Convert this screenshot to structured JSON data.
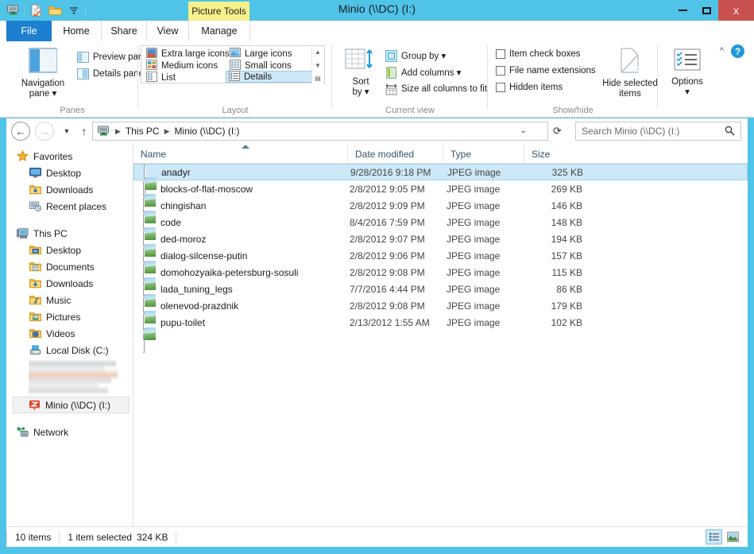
{
  "window": {
    "title": "Minio (\\\\DC) (I:)",
    "context_tab_label": "Picture Tools",
    "minimize_label": "Minimize",
    "maximize_label": "Maximize",
    "close_label": "x",
    "accent_color": "#4fc3e8",
    "close_color": "#c9514e"
  },
  "quick_access": [
    {
      "name": "network-drive-icon",
      "label": "Network drive"
    },
    {
      "name": "properties-icon",
      "label": "Properties"
    },
    {
      "name": "new-folder-icon",
      "label": "New folder"
    },
    {
      "name": "customize-qat-icon",
      "label": "Customize Quick Access Toolbar"
    }
  ],
  "tabs": [
    {
      "label": "File",
      "active": false,
      "kind": "file"
    },
    {
      "label": "Home",
      "active": false,
      "kind": "normal"
    },
    {
      "label": "Share",
      "active": false,
      "kind": "normal"
    },
    {
      "label": "View",
      "active": true,
      "kind": "normal"
    },
    {
      "label": "Manage",
      "active": false,
      "kind": "context"
    }
  ],
  "ribbon": {
    "help_label": "?",
    "collapse_label": "^",
    "groups": [
      {
        "label": "Panes"
      },
      {
        "label": "Layout"
      },
      {
        "label": "Current view"
      },
      {
        "label": "Show/hide"
      }
    ],
    "panes": {
      "navigation_pane": "Navigation\npane",
      "navigation_pane_line1": "Navigation",
      "navigation_pane_line2": "pane",
      "preview_pane": "Preview pane",
      "details_pane": "Details pane"
    },
    "layout": {
      "options": [
        {
          "label": "Extra large icons",
          "selected": false
        },
        {
          "label": "Large icons",
          "selected": false
        },
        {
          "label": "Medium icons",
          "selected": false
        },
        {
          "label": "Small icons",
          "selected": false
        },
        {
          "label": "List",
          "selected": false
        },
        {
          "label": "Details",
          "selected": true
        }
      ]
    },
    "current_view": {
      "sort_by_line1": "Sort",
      "sort_by_line2": "by",
      "group_by": "Group by",
      "add_columns": "Add columns",
      "size_all_columns": "Size all columns to fit"
    },
    "show_hide": {
      "item_check_boxes": {
        "label": "Item check boxes",
        "checked": false
      },
      "file_name_extensions": {
        "label": "File name extensions",
        "checked": false
      },
      "hidden_items": {
        "label": "Hidden items",
        "checked": false
      },
      "hide_selected_line1": "Hide selected",
      "hide_selected_line2": "items",
      "options": "Options"
    }
  },
  "address_bar": {
    "back_label": "Back",
    "forward_label": "Forward",
    "history_label": "Recent locations",
    "up_label": "Up",
    "breadcrumbs": [
      "This PC",
      "Minio (\\\\DC) (I:)"
    ],
    "dropdown_label": "Previous locations",
    "refresh_label": "Refresh",
    "search_placeholder": "Search Minio (\\\\DC) (I:)"
  },
  "nav_pane": {
    "groups": [
      {
        "header": {
          "label": "Favorites",
          "icon": "star-icon"
        },
        "items": [
          {
            "label": "Desktop",
            "icon": "desktop-icon"
          },
          {
            "label": "Downloads",
            "icon": "downloads-folder-icon"
          },
          {
            "label": "Recent places",
            "icon": "recent-places-icon"
          }
        ]
      },
      {
        "header": {
          "label": "This PC",
          "icon": "this-pc-icon"
        },
        "items": [
          {
            "label": "Desktop",
            "icon": "desktop-folder-icon"
          },
          {
            "label": "Documents",
            "icon": "documents-folder-icon"
          },
          {
            "label": "Downloads",
            "icon": "downloads-folder-icon"
          },
          {
            "label": "Music",
            "icon": "music-folder-icon"
          },
          {
            "label": "Pictures",
            "icon": "pictures-folder-icon"
          },
          {
            "label": "Videos",
            "icon": "videos-folder-icon"
          },
          {
            "label": "Local Disk (C:)",
            "icon": "local-disk-icon"
          }
        ]
      }
    ],
    "redacted_block": {
      "label": "",
      "blurred": true
    },
    "selected_drive": {
      "label": "Minio (\\\\DC) (I:)",
      "icon": "network-drive-icon",
      "selected": true
    },
    "network": {
      "label": "Network",
      "icon": "network-icon"
    }
  },
  "file_list": {
    "columns": [
      {
        "label": "Name"
      },
      {
        "label": "Date modified"
      },
      {
        "label": "Type"
      },
      {
        "label": "Size"
      }
    ],
    "sort_column": "Name",
    "sort_direction": "ascending",
    "rows": [
      {
        "name": "anadyr",
        "date": "9/28/2016 9:18 PM",
        "type": "JPEG image",
        "size": "325 KB",
        "selected": true
      },
      {
        "name": "blocks-of-flat-moscow",
        "date": "2/8/2012 9:05 PM",
        "type": "JPEG image",
        "size": "269 KB",
        "selected": false
      },
      {
        "name": "chingishan",
        "date": "2/8/2012 9:09 PM",
        "type": "JPEG image",
        "size": "146 KB",
        "selected": false
      },
      {
        "name": "code",
        "date": "8/4/2016 7:59 PM",
        "type": "JPEG image",
        "size": "148 KB",
        "selected": false
      },
      {
        "name": "ded-moroz",
        "date": "2/8/2012 9:07 PM",
        "type": "JPEG image",
        "size": "194 KB",
        "selected": false
      },
      {
        "name": "dialog-silcense-putin",
        "date": "2/8/2012 9:06 PM",
        "type": "JPEG image",
        "size": "157 KB",
        "selected": false
      },
      {
        "name": "domohozyaika-petersburg-sosuli",
        "date": "2/8/2012 9:08 PM",
        "type": "JPEG image",
        "size": "115 KB",
        "selected": false
      },
      {
        "name": "lada_tuning_legs",
        "date": "7/7/2016 4:44 PM",
        "type": "JPEG image",
        "size": "86 KB",
        "selected": false
      },
      {
        "name": "olenevod-prazdnik",
        "date": "2/8/2012 9:08 PM",
        "type": "JPEG image",
        "size": "179 KB",
        "selected": false
      },
      {
        "name": "pupu-toilet",
        "date": "2/13/2012 1:55 AM",
        "type": "JPEG image",
        "size": "102 KB",
        "selected": false
      }
    ]
  },
  "status_bar": {
    "item_count": "10 items",
    "selection": "1 item selected",
    "selection_size": "324 KB",
    "details_view_label": "Details view",
    "large_icons_view_label": "Large icons view"
  }
}
